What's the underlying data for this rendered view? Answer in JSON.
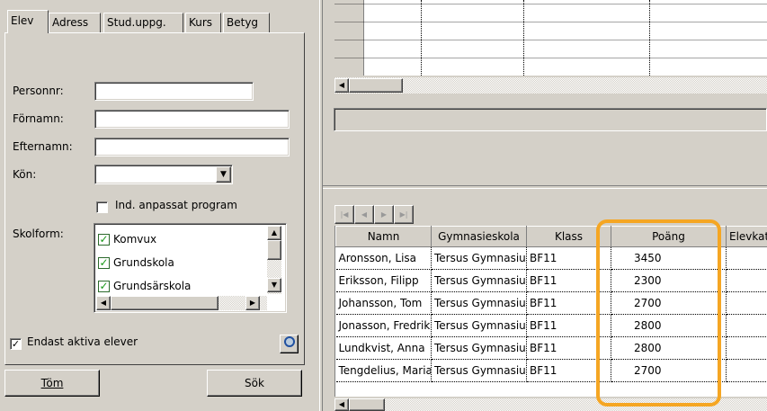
{
  "tabs": [
    {
      "label": "Elev",
      "active": true
    },
    {
      "label": "Adress",
      "active": false
    },
    {
      "label": "Stud.uppg.",
      "active": false
    },
    {
      "label": "Kurs",
      "active": false
    },
    {
      "label": "Betyg",
      "active": false
    }
  ],
  "form": {
    "personnr_label": "Personnr:",
    "personnr_value": "",
    "fornamn_label": "Förnamn:",
    "fornamn_value": "",
    "efternamn_label": "Efternamn:",
    "efternamn_value": "",
    "kon_label": "Kön:",
    "kon_value": "",
    "ind_program_label": "Ind. anpassat program",
    "ind_program_checked": false,
    "skolform_label": "Skolform:",
    "skolform_items": [
      {
        "label": "Komvux",
        "checked": true
      },
      {
        "label": "Grundskola",
        "checked": true
      },
      {
        "label": "Grundsärskola",
        "checked": true
      }
    ],
    "endast_aktiva_label": "Endast aktiva elever",
    "endast_aktiva_checked": true
  },
  "buttons": {
    "tom_label": "Töm",
    "sok_label": "Sök"
  },
  "grid": {
    "columns": [
      "Namn",
      "Gymnasieskola",
      "Klass",
      "Poäng",
      "Elevkat"
    ],
    "rows": [
      [
        "Aronsson, Lisa",
        "Tersus Gymnasium",
        "BF11",
        "3450",
        ""
      ],
      [
        "Eriksson, Filipp",
        "Tersus Gymnasium",
        "BF11",
        "2300",
        ""
      ],
      [
        "Johansson, Tom",
        "Tersus Gymnasium",
        "BF11",
        "2700",
        ""
      ],
      [
        "Jonasson, Fredrik",
        "Tersus Gymnasium",
        "BF11",
        "2800",
        ""
      ],
      [
        "Lundkvist, Anna",
        "Tersus Gymnasium",
        "BF11",
        "2800",
        ""
      ],
      [
        "Tengdelius, Maria",
        "Tersus Gymnasium",
        "BF11",
        "2700",
        ""
      ]
    ]
  },
  "colors": {
    "highlight": "#f5a623",
    "face": "#d4d0c8",
    "check_green": "#1a9a1a"
  }
}
